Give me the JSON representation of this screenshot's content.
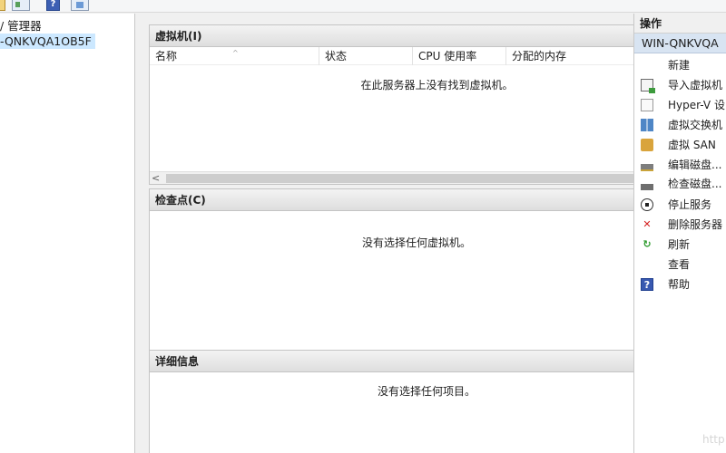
{
  "toolbar": {
    "icons": [
      "folder-icon",
      "view-icon",
      "help-icon",
      "panel-icon"
    ],
    "help_glyph": "?"
  },
  "tree": {
    "root_label": "/ 管理器",
    "server_label": "-QNKVQA1OB5F"
  },
  "virtual_machines": {
    "title": "虚拟机(I)",
    "columns": [
      "名称",
      "状态",
      "CPU 使用率",
      "分配的内存"
    ],
    "sort_indicator": "^",
    "rows": [],
    "empty_message": "在此服务器上没有找到虚拟机。",
    "scroll_left": "<"
  },
  "checkpoints": {
    "title": "检查点(C)",
    "empty_message": "没有选择任何虚拟机。"
  },
  "details": {
    "title": "详细信息",
    "empty_message": "没有选择任何项目。"
  },
  "actions": {
    "title": "操作",
    "server": "WIN-QNKVQA",
    "items": [
      {
        "label": "新建",
        "icon": ""
      },
      {
        "label": "导入虚拟机",
        "icon": "import-icon"
      },
      {
        "label": "Hyper-V 设",
        "icon": "hyperv-settings-icon"
      },
      {
        "label": "虚拟交换机",
        "icon": "virtual-switch-icon"
      },
      {
        "label": "虚拟 SAN",
        "icon": "san-icon"
      },
      {
        "label": "编辑磁盘...",
        "icon": "edit-disk-icon"
      },
      {
        "label": "检查磁盘...",
        "icon": "inspect-disk-icon"
      },
      {
        "label": "停止服务",
        "icon": "stop-icon"
      },
      {
        "label": "删除服务器",
        "icon": "delete-icon"
      },
      {
        "label": "刷新",
        "icon": "refresh-icon"
      },
      {
        "label": "查看",
        "icon": ""
      },
      {
        "label": "帮助",
        "icon": "help-icon"
      }
    ],
    "glyphs": {
      "delete": "✕",
      "refresh": "↻",
      "help": "?"
    }
  },
  "watermark": "http"
}
